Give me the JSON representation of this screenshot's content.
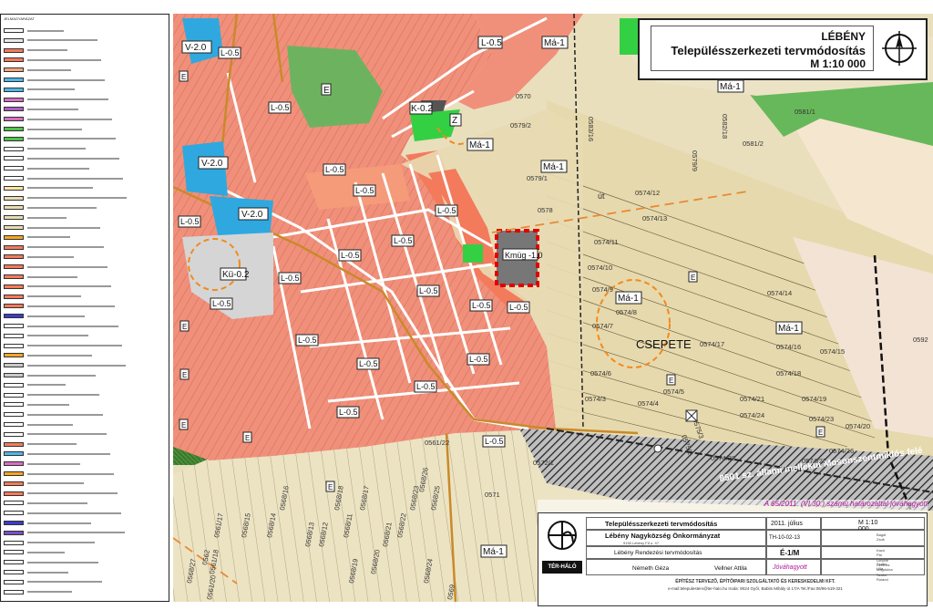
{
  "legend": {
    "heading": "JELMAGYARÁZAT",
    "rows": [
      {
        "color": "#ffffff"
      },
      {
        "color": "#e8e8e8"
      },
      {
        "color": "#f47a5c"
      },
      {
        "color": "#f47a5c"
      },
      {
        "color": "#fca57a"
      },
      {
        "color": "#4db8e8"
      },
      {
        "color": "#4db8e8"
      },
      {
        "color": "#d76fc2"
      },
      {
        "color": "#b05cc4"
      },
      {
        "color": "#d76fc2"
      },
      {
        "color": "#4fc44a"
      },
      {
        "color": "#4fc44a"
      },
      {
        "color": "#ffffff"
      },
      {
        "color": "#ffffff"
      },
      {
        "color": "#ffffff"
      },
      {
        "color": "#ffffff"
      },
      {
        "color": "#fde4a0"
      },
      {
        "color": "#e8dcb0"
      },
      {
        "color": "#e8dcb0"
      },
      {
        "color": "#e8dcb0"
      },
      {
        "color": "#e8dcb0"
      },
      {
        "color": "#f5a623"
      },
      {
        "color": "#f47a5c"
      },
      {
        "color": "#f47a5c"
      },
      {
        "color": "#f47a5c"
      },
      {
        "color": "#f47a5c"
      },
      {
        "color": "#f47a5c"
      },
      {
        "color": "#f47a5c"
      },
      {
        "color": "#f47a5c"
      },
      {
        "color": "#3c3cc8"
      },
      {
        "color": "#ffffff"
      },
      {
        "color": "#ffffff"
      },
      {
        "color": "#ffffff"
      },
      {
        "color": "#f5a623"
      },
      {
        "color": "#c8c8c8"
      },
      {
        "color": "#c8c8c8"
      },
      {
        "color": "#ffffff"
      },
      {
        "color": "#ffffff"
      },
      {
        "color": "#ffffff"
      },
      {
        "color": "#ffffff"
      },
      {
        "color": "#ffffff"
      },
      {
        "color": "#ffffff"
      },
      {
        "color": "#f47a5c"
      },
      {
        "color": "#4db8e8"
      },
      {
        "color": "#d76fc2"
      },
      {
        "color": "#f5a623"
      },
      {
        "color": "#f47a5c"
      },
      {
        "color": "#f47a5c"
      },
      {
        "color": "#ffffff"
      },
      {
        "color": "#ffffff"
      },
      {
        "color": "#3c3cc8"
      },
      {
        "color": "#7a4ec8"
      },
      {
        "color": "#ffffff"
      },
      {
        "color": "#ffffff"
      },
      {
        "color": "#ffffff"
      },
      {
        "color": "#ffffff"
      },
      {
        "color": "#ffffff"
      },
      {
        "color": "#ffffff"
      }
    ]
  },
  "title": {
    "line1": "LÉBÉNY",
    "line2": "Településszerkezeti tervmódosítás",
    "line3": "M 1:10 000"
  },
  "approval": "A 65/2011. (VI.30.) számú határozattal jóváhagyott",
  "stamp": {
    "plan_name": "Településszerkezeti tervmódosítás",
    "date": "2011. július",
    "scale": "M 1:10 000",
    "client": "Lébény Nagyközség Önkormányzat",
    "client_address": "9155 Lébény Fő u. 47.",
    "project": "Lébény Rendezési tervmódosítás",
    "project_no": "TH-10-02-13",
    "sheet": "É-1/M",
    "designer1": "Németh Géza",
    "designer2": "Vellner Attila",
    "approved_word": "Jóváhagyott",
    "company_logo": "TÉR-HÁLÓ",
    "company_line1": "ÉPÍTÉSZ TERVEZŐ, ÉPÍTŐIPARI SZOLGÁLTATÓ ÉS KERESKEDELMI KFT.",
    "company_line2": "e-mail:telepulesterv@ter-halo.hu Iroda: 9024 Győr, Babits Mihály út 17/A Tel./Fax:06/96-519-321",
    "persons": [
      "Bagdi Zsolt",
      "Kazó Pál",
      "Limpné Czémez Magdolna",
      "Szabó Lilla",
      "Szabó Roland"
    ]
  },
  "map_labels": {
    "zones": [
      "V-2.0",
      "L-0.5",
      "Má-1",
      "K-0.2",
      "Z",
      "E",
      "Kmüg -1.0",
      "V-2.0",
      "V-2.0",
      "Kü-0.2",
      "Má-1",
      "Má-1",
      "Má-1",
      "Má-1",
      "Má-1",
      "Má-1"
    ],
    "csepete": "CSEPETE",
    "road": "8501 sz. állami mellékút Mosonszentmiklós felé",
    "ut": "út",
    "parcels": [
      "0579/2",
      "0583/16",
      "0579/1",
      "0578",
      "0574/12",
      "0574/13",
      "0574/11",
      "0574/10",
      "0574/9",
      "0574/8",
      "0574/7",
      "0574/6",
      "0574/14",
      "0574/15",
      "0574/16",
      "0574/17",
      "0574/18",
      "0574/19",
      "0574/20",
      "0574/21",
      "0574/23",
      "0574/24",
      "0574/26",
      "0574/27",
      "0574/28",
      "0574/3",
      "0574/4",
      "0574/5",
      "0572/1",
      "0571",
      "0575/3",
      "0575/2",
      "0568/13",
      "0568/12",
      "0568/11",
      "0568/14",
      "0568/15",
      "0568/16",
      "0568/17",
      "0568/18",
      "0568/19",
      "0568/20",
      "0568/21",
      "0568/22",
      "0568/23",
      "0568/24",
      "0568/25",
      "0568/26",
      "0568/27",
      "0562",
      "0561/17",
      "0561/18",
      "0561/20",
      "0561/22",
      "0569",
      "0570",
      "0579/9",
      "0582/18",
      "0581/2",
      "0581/1",
      "0592",
      "04/1"
    ]
  }
}
